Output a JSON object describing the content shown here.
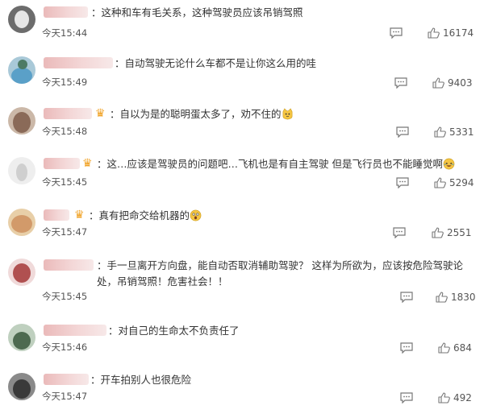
{
  "comments": [
    {
      "text": "：这种和车有毛关系，这种驾驶员应该吊销驾照",
      "time": "今天15:44",
      "likes": "16174",
      "avatar_color": "#6c6c6c"
    },
    {
      "text": "：自动驾驶无论什么车都不是让你这么用的哇",
      "time": "今天15:49",
      "likes": "9403",
      "avatar_color": "#5aa0c8"
    },
    {
      "text": "：自以为是的聪明蛋太多了，劝不住的",
      "time": "今天15:48",
      "likes": "5331",
      "avatar_color": "#8a6a58"
    },
    {
      "text": "：这…应该是驾驶员的问题吧…飞机也是有自主驾驶 但是飞行员也不能睡觉啊",
      "time": "今天15:45",
      "likes": "5294",
      "avatar_color": "#cfcfcf"
    },
    {
      "text": "：真有把命交给机器的",
      "time": "今天15:47",
      "likes": "2551",
      "avatar_color": "#d29a6a"
    },
    {
      "text": "：手一旦离开方向盘，能自动否取消辅助驾驶？ 这样为所欲为，应该按危险驾驶论处，吊销驾照！危害社会！！",
      "time": "今天15:45",
      "likes": "1830",
      "avatar_color": "#b05050"
    },
    {
      "text": "：对自己的生命太不负责任了",
      "time": "今天15:46",
      "likes": "684",
      "avatar_color": "#4d6a50"
    },
    {
      "text": "：开车拍别人也很危险",
      "time": "今天15:47",
      "likes": "492",
      "avatar_color": "#3a3a3a"
    }
  ]
}
